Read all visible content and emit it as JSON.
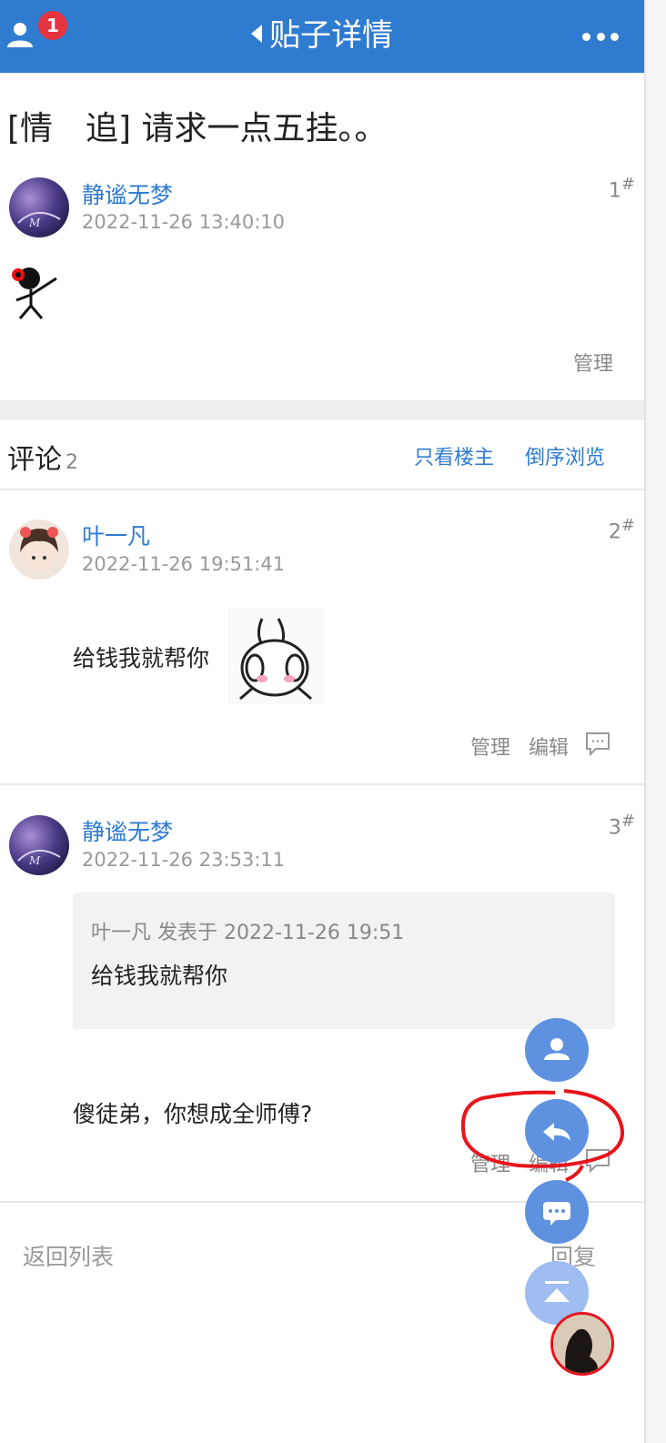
{
  "header": {
    "title": "贴子详情",
    "notification_count": "1",
    "icons": {
      "user": "user-icon",
      "back": "back-triangle-icon",
      "more": "more-dots-icon"
    }
  },
  "post": {
    "title": "[情　追] 请求一点五挂。。",
    "floor1": {
      "author": "静谧无梦",
      "time": "2022-11-26 13:40:10",
      "floor": "1",
      "manage": "管理"
    }
  },
  "comments": {
    "label": "评论",
    "count": "2",
    "only_owner": "只看楼主",
    "reverse": "倒序浏览",
    "items": [
      {
        "author": "叶一凡",
        "time": "2022-11-26 19:51:41",
        "floor": "2",
        "text": "给钱我就帮你",
        "manage": "管理",
        "edit": "编辑"
      },
      {
        "author": "静谧无梦",
        "time": "2022-11-26 23:53:11",
        "floor": "3",
        "quote_meta": "叶一凡 发表于 2022-11-26 19:51",
        "quote_text": "给钱我就帮你",
        "text": "傻徒弟，你想成全师傅?",
        "manage": "管理",
        "edit": "编辑"
      }
    ]
  },
  "footer": {
    "back_to_list": "返回列表",
    "reply": "回复"
  },
  "colors": {
    "header_bg": "#2f7bd0",
    "link": "#2f7bd0",
    "badge": "#e3343f",
    "fab": "#5e91e0",
    "annotation": "#e8141c"
  }
}
